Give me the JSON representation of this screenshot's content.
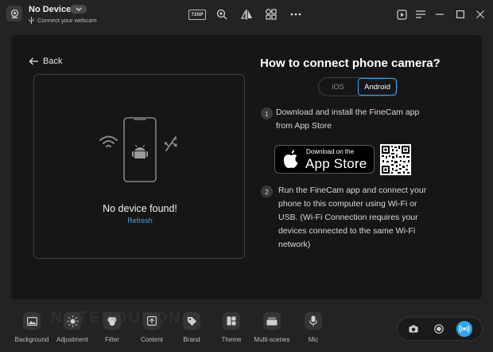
{
  "titlebar": {
    "device_name": "No Device",
    "subtitle": "Connect your webcam",
    "resolution": "720P"
  },
  "left": {
    "back_label": "Back",
    "no_device": "No device found!",
    "refresh": "Refresh"
  },
  "right": {
    "heading": "How to connect phone camera?",
    "platform_tabs": {
      "ios": "iOS",
      "android": "Android",
      "selected": "Android"
    },
    "step1": {
      "num": "1",
      "line1": "Download and install the FineCam app",
      "line2": "from App Store"
    },
    "appstore": {
      "small": "Download on the",
      "big": "App Store"
    },
    "step2": {
      "num": "2",
      "line1": "Run the FineCam app and connect your",
      "line2": "phone to this computer using Wi-Fi or",
      "line3": "USB. (Wi-Fi Connection requires your",
      "line4": "devices connected to the same Wi-Fi",
      "line5": "network)"
    }
  },
  "toolbar": {
    "items": [
      {
        "label": "Background",
        "icon": "image-icon"
      },
      {
        "label": "Adjustment",
        "icon": "sun-icon"
      },
      {
        "label": "Filter",
        "icon": "filter-icon"
      },
      {
        "label": "Content",
        "icon": "upload-icon"
      },
      {
        "label": "Brand",
        "icon": "tag-icon"
      },
      {
        "label": "Theme",
        "icon": "theme-icon"
      },
      {
        "label": "Multi-scenes",
        "icon": "scenes-icon"
      },
      {
        "label": "Mic",
        "icon": "mic-icon"
      }
    ],
    "watermark": "NOTEBOURON"
  },
  "colors": {
    "accent": "#29a8f2",
    "background": "#232323",
    "panel": "#161616"
  }
}
